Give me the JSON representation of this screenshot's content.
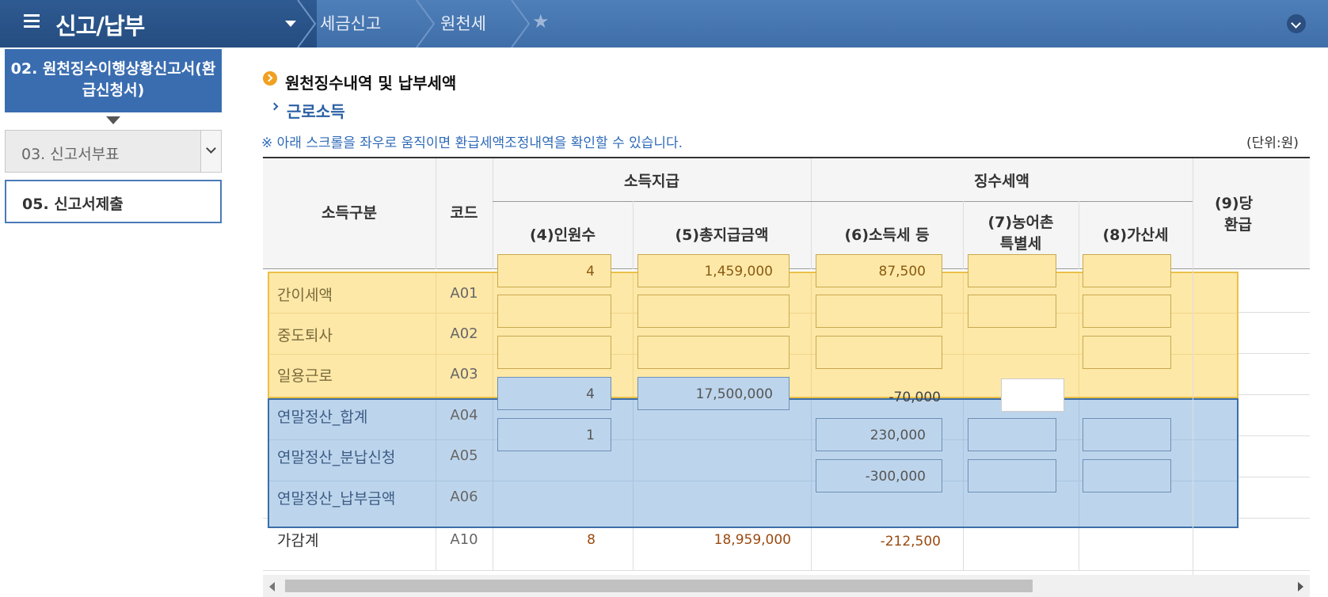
{
  "header": {
    "menu_title": "신고/납부",
    "breadcrumb": [
      "세금신고",
      "원천세"
    ]
  },
  "sidebar": {
    "active": {
      "num": "02.",
      "label": "원천징수이행상황신고서(환급신청서)"
    },
    "select": {
      "num": "03.",
      "label": "신고서부표"
    },
    "item": {
      "num": "05.",
      "label": "신고서제출"
    }
  },
  "content": {
    "section_title": "원천징수내역 및 납부세액",
    "sub_title": "근로소득",
    "notice": "※ 아래 스크롤을 좌우로 움직이면 환급세액조정내역을 확인할 수 있습니다.",
    "unit": "(단위:원)"
  },
  "table": {
    "headers": {
      "income_type": "소득구분",
      "code": "코드",
      "group_payment": "소득지급",
      "group_tax": "징수세액",
      "count": "(4)인원수",
      "total_pay": "(5)총지급금액",
      "income_tax": "(6)소득세 등",
      "farm_tax_line1": "(7)농어촌",
      "farm_tax_line2": "특별세",
      "penalty": "(8)가산세",
      "col9_line1": "(9)당",
      "col9_line2": "환급"
    },
    "rows": [
      {
        "label": "간이세액",
        "code": "A01",
        "count": "4",
        "total_pay": "1,459,000",
        "income_tax": "87,500"
      },
      {
        "label": "중도퇴사",
        "code": "A02",
        "count": "",
        "total_pay": "",
        "income_tax": ""
      },
      {
        "label": "일용근로",
        "code": "A03",
        "count": "",
        "total_pay": "",
        "income_tax": ""
      },
      {
        "label": "연말정산_합계",
        "code": "A04",
        "count": "4",
        "total_pay": "17,500,000",
        "income_tax": "-70,000"
      },
      {
        "label": "연말정산_분납신청",
        "code": "A05",
        "count": "1",
        "total_pay": "",
        "income_tax": "230,000"
      },
      {
        "label": "연말정산_납부금액",
        "code": "A06",
        "count": "",
        "total_pay": "",
        "income_tax": "-300,000"
      },
      {
        "label": "가감계",
        "code": "A10",
        "count": "8",
        "total_pay": "18,959,000",
        "income_tax": "-212,500"
      }
    ]
  },
  "colors": {
    "header_bg": "#3f6ea8",
    "yellow_band": "#fde8a8",
    "blue_band": "#bdd5ec",
    "accent_orange": "#f0a020"
  }
}
